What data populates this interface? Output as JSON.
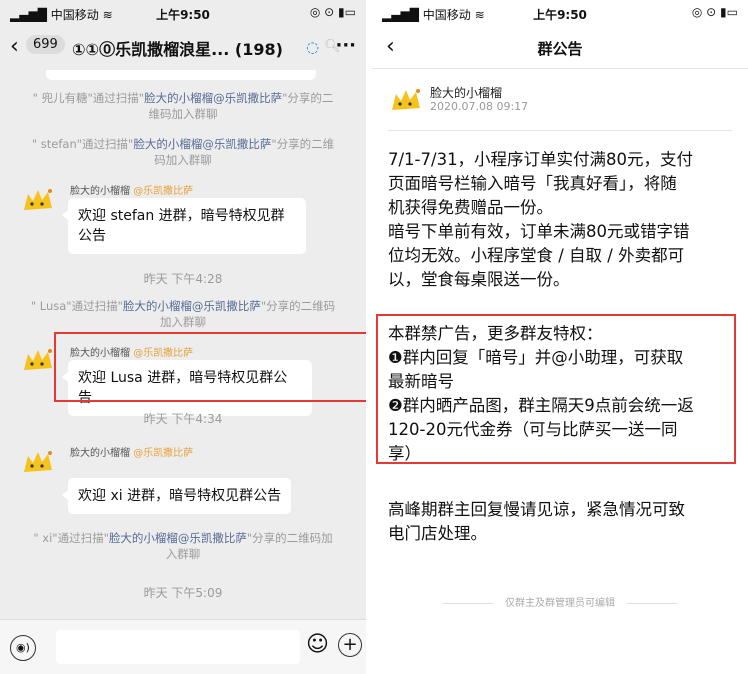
{
  "left": {
    "status": {
      "carrier": "中国移动",
      "time": "上午9:50"
    },
    "header": {
      "unread": "699",
      "title": "①①⓪乐凯撒榴浪星... (198)"
    },
    "messages": {
      "sys1": {
        "a": "\" 兜儿有糖\"通过扫描\"",
        "link": "脸大的小榴榴@乐凯撒比萨",
        "b": "\"分享的二维码加入群聊"
      },
      "sys2": {
        "a": "\" stefan\"通过扫描\"",
        "link": "脸大的小榴榴@乐凯撒比萨",
        "b": "\"分享的二维码加入群聊"
      },
      "msg1": {
        "sender": "脸大的小榴榴",
        "at": "@乐凯撒比萨",
        "line1": "欢迎 stefan 进群，暗号特权见群",
        "line2": "公告"
      },
      "ts1": "昨天 下午4:28",
      "sys3": {
        "a": "\" Lusa\"通过扫描\"",
        "link": "脸大的小榴榴@乐凯撒比萨",
        "b": "\"分享的二维码加入群聊"
      },
      "msg2": {
        "sender": "脸大的小榴榴",
        "at": "@乐凯撒比萨",
        "line1": "欢迎 Lusa 进群，暗号特权见群公",
        "line2": "告"
      },
      "ts2": "昨天 下午4:34",
      "msg3": {
        "sender": "脸大的小榴榴",
        "at": "@乐凯撒比萨",
        "line1": "欢迎 xi 进群，暗号特权见群公告"
      },
      "sys4": {
        "a": "\" xi\"通过扫描\"",
        "link": "脸大的小榴榴@乐凯撒比萨",
        "b": "\"分享的二维码加入群聊"
      },
      "ts3": "昨天 下午5:09"
    }
  },
  "right": {
    "status": {
      "carrier": "中国移动",
      "time": "上午9:50"
    },
    "title": "群公告",
    "author": {
      "name": "脸大的小榴榴",
      "date": "2020.07.08 09:17"
    },
    "p1": [
      "7/1-7/31，小程序订单实付满80元，支付",
      "页面暗号栏输入暗号「我真好看」，将随",
      "机获得免费赠品一份。",
      "暗号下单前有效，订单未满80元或错字错",
      "位均无效。小程序堂食 / 自取 / 外卖都可",
      "以，堂食每桌限送一份。"
    ],
    "p2": [
      "本群禁广告，更多群友特权：",
      "❶群内回复「暗号」并@小助理，可获取",
      "最新暗号",
      "❷群内晒产品图，群主隔天9点前会统一返",
      "120-20元代金券（可与比萨买一送一同",
      "享）"
    ],
    "p3": [
      "高峰期群主回复慢请见谅，紧急情况可致",
      "电门店处理。"
    ],
    "footer": "仅群主及群管理员可编辑"
  },
  "colors": {
    "highlight": "#e53935",
    "link": "#576b95",
    "mention": "#e6a23c"
  }
}
